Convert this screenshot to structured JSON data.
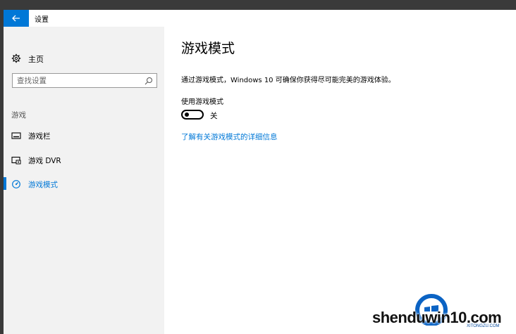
{
  "window": {
    "title": "设置"
  },
  "sidebar": {
    "home_label": "主页",
    "search_placeholder": "查找设置",
    "section_label": "游戏",
    "items": [
      {
        "label": "游戏栏",
        "icon": "game-bar-icon",
        "active": false
      },
      {
        "label": "游戏 DVR",
        "icon": "game-dvr-icon",
        "active": false
      },
      {
        "label": "游戏模式",
        "icon": "game-mode-icon",
        "active": true
      }
    ]
  },
  "main": {
    "title": "游戏模式",
    "description": "通过游戏模式，Windows 10 可确保你获得尽可能完美的游戏体验。",
    "setting_label": "使用游戏模式",
    "toggle_state": "关",
    "link_text": "了解有关游戏模式的详细信息"
  },
  "watermark": {
    "text": "shenduwin10.com",
    "sub": "XITONGZU.COM"
  },
  "colors": {
    "accent": "#0078d7",
    "sidebar_bg": "#f2f2f2",
    "frame": "#3a3a3a"
  }
}
